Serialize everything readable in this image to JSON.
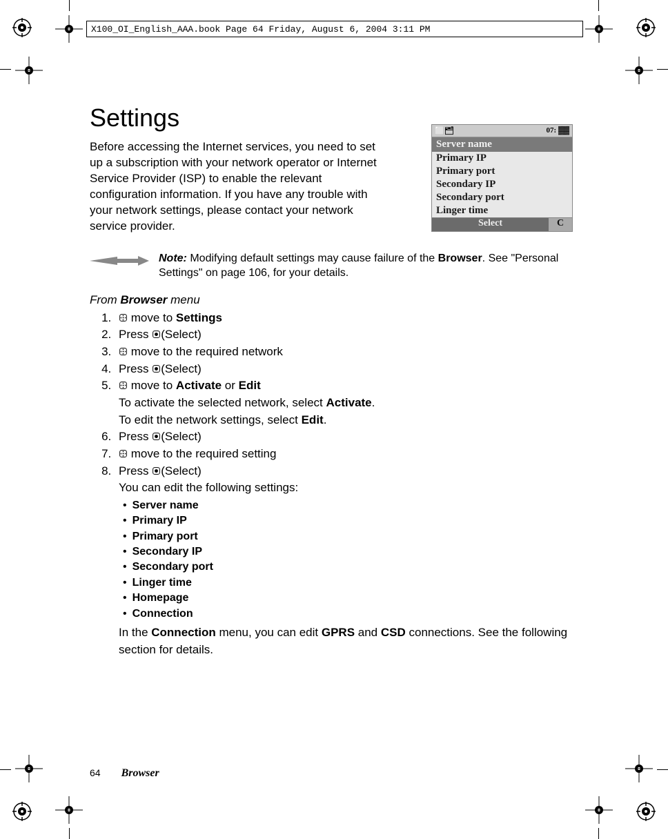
{
  "header_text": "X100_OI_English_AAA.book  Page 64  Friday, August 6, 2004  3:11 PM",
  "title": "Settings",
  "intro": "Before accessing the Internet services, you need to set up a subscription with your network operator or Internet Service Provider (ISP) to enable the relevant configuration information. If you have any trouble with your network settings, please contact your network service provider.",
  "phone": {
    "status_left": "⬜🗂",
    "status_right": "07: ▓▓",
    "header": "Server name",
    "items": [
      "Primary IP",
      "Primary port",
      "Secondary IP",
      "Secondary port",
      "Linger time"
    ],
    "softkey_left": "Select",
    "softkey_right": "C"
  },
  "note": {
    "label": "Note:",
    "text_before": " Modifying default settings may cause failure of the ",
    "bold_browser": "Browser",
    "text_after": ". See \"Personal Settings\" on page 106, for your details."
  },
  "menu_path_prefix": "From ",
  "menu_path_bold": "Browser",
  "menu_path_suffix": " menu",
  "steps": {
    "s1_a": " move to ",
    "s1_b": "Settings",
    "s2": "Press ",
    "s2b": "(Select)",
    "s3": " move to the required network",
    "s4": "Press ",
    "s4b": "(Select)",
    "s5_a": " move to ",
    "s5_b1": "Activate",
    "s5_or": " or ",
    "s5_b2": "Edit",
    "s5_line2a": "To activate the selected network, select ",
    "s5_line2b": "Activate",
    "s5_line2c": ".",
    "s5_line3a": "To edit the network settings, select ",
    "s5_line3b": "Edit",
    "s5_line3c": ".",
    "s6": "Press ",
    "s6b": "(Select)",
    "s7": " move to the required setting",
    "s8": "Press ",
    "s8b": "(Select)",
    "s8_line2": "You can edit the following settings:"
  },
  "bullets": [
    "Server name",
    "Primary IP",
    "Primary port",
    "Secondary IP",
    "Secondary port",
    "Linger time",
    "Homepage",
    "Connection"
  ],
  "connection_para": {
    "a": "In the ",
    "b1": "Connection",
    "c": " menu, you can edit ",
    "b2": "GPRS",
    "d": " and ",
    "b3": "CSD",
    "e": " connections. See the following section for details."
  },
  "footer": {
    "page": "64",
    "section": "Browser"
  }
}
